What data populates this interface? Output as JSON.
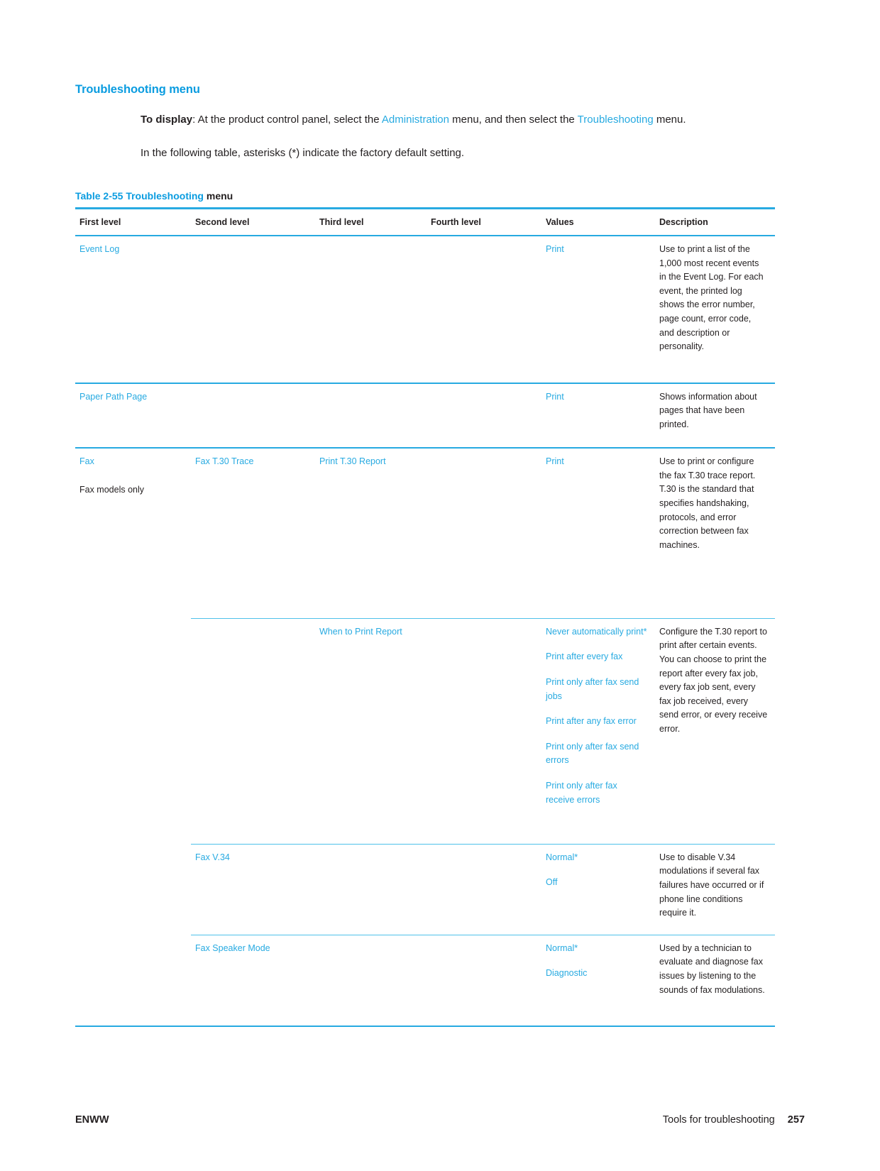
{
  "colors": {
    "accent_blue": "#27aae1",
    "heading_blue": "#0a9ce0",
    "text_black": "#231f20"
  },
  "section": {
    "heading": "Troubleshooting menu",
    "paragraph1": {
      "lead_bold": "To display",
      "text_a": ": At the product control panel, select the ",
      "link_a": "Administration",
      "text_b": " menu, and then select the ",
      "link_b": "Troubleshooting",
      "text_c": " menu."
    },
    "paragraph2": "In the following table, asterisks (*) indicate the factory default setting."
  },
  "table": {
    "caption_blue": "Table 2-55  Troubleshooting",
    "caption_black": " menu",
    "headers": [
      "First level",
      "Second level",
      "Third level",
      "Fourth level",
      "Values",
      "Description"
    ],
    "rows": [
      {
        "first_level": "Event Log",
        "first_level_note": "",
        "second_level": "",
        "third_level": "",
        "fourth_level": "",
        "values": [
          "Print"
        ],
        "default_marker": "",
        "description": "Use to print a list of the 1,000 most recent events in the Event Log. For each event, the printed log shows the error number, page count, error code, and description or personality."
      },
      {
        "first_level": "Paper Path Page",
        "first_level_note": "",
        "second_level": "",
        "third_level": "",
        "fourth_level": "",
        "values": [
          "Print"
        ],
        "default_marker": "",
        "description": "Shows information about pages that have been printed."
      },
      {
        "first_level": "Fax",
        "first_level_note": "Fax models only",
        "second_level": "Fax T.30 Trace",
        "third_level": "Print T.30 Report",
        "fourth_level": "",
        "values": [
          "Print"
        ],
        "default_marker": "",
        "description": "Use to print or configure the fax T.30 trace report. T.30 is the standard that specifies handshaking, protocols, and error correction between fax machines."
      },
      {
        "first_level": "",
        "first_level_note": "",
        "second_level": "",
        "third_level": "When to Print Report",
        "fourth_level": "",
        "values": [
          "Never automatically print*",
          "Print after every fax",
          "Print only after fax send jobs",
          "Print after any fax error",
          "Print only after fax send errors",
          "Print only after fax receive errors"
        ],
        "default_marker": "*",
        "description": "Configure the T.30 report to print after certain events. You can choose to print the report after every fax job, every fax job sent, every fax job received, every send error, or every receive error."
      },
      {
        "first_level": "",
        "first_level_note": "",
        "second_level": "Fax V.34",
        "third_level": "",
        "fourth_level": "",
        "values": [
          "Normal*",
          "Off"
        ],
        "default_marker": "*",
        "description": "Use to disable V.34 modulations if several fax failures have occurred or if phone line conditions require it."
      },
      {
        "first_level": "",
        "first_level_note": "",
        "second_level": "Fax Speaker Mode",
        "third_level": "",
        "fourth_level": "",
        "values": [
          "Normal*",
          "Diagnostic"
        ],
        "default_marker": "*",
        "description": "Used by a technician to evaluate and diagnose fax issues by listening to the sounds of fax modulations."
      }
    ]
  },
  "footer": {
    "left": "ENWW",
    "right_label": "Tools for troubleshooting",
    "page_number": "257"
  }
}
